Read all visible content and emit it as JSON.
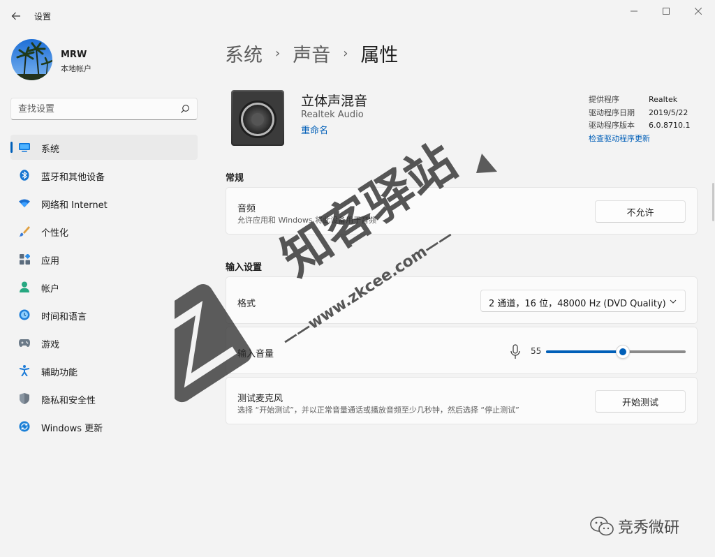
{
  "window": {
    "title": "设置"
  },
  "user": {
    "name": "MRW",
    "account_type": "本地帐户"
  },
  "search": {
    "placeholder": "查找设置"
  },
  "nav": {
    "items": [
      {
        "label": "系统",
        "icon": "monitor-icon",
        "active": true
      },
      {
        "label": "蓝牙和其他设备",
        "icon": "bluetooth-icon"
      },
      {
        "label": "网络和 Internet",
        "icon": "wifi-icon"
      },
      {
        "label": "个性化",
        "icon": "brush-icon"
      },
      {
        "label": "应用",
        "icon": "apps-icon"
      },
      {
        "label": "帐户",
        "icon": "person-icon"
      },
      {
        "label": "时间和语言",
        "icon": "globe-clock-icon"
      },
      {
        "label": "游戏",
        "icon": "gamepad-icon"
      },
      {
        "label": "辅助功能",
        "icon": "accessibility-icon"
      },
      {
        "label": "隐私和安全性",
        "icon": "shield-icon"
      },
      {
        "label": "Windows 更新",
        "icon": "update-icon"
      }
    ]
  },
  "breadcrumb": {
    "items": [
      "系统",
      "声音"
    ],
    "current": "属性",
    "separator": "›"
  },
  "device": {
    "name": "立体声混音",
    "subtitle": "Realtek Audio",
    "rename": "重命名",
    "info": [
      {
        "key": "提供程序",
        "value": "Realtek"
      },
      {
        "key": "驱动程序日期",
        "value": "2019/5/22"
      },
      {
        "key": "驱动程序版本",
        "value": "6.0.8710.1"
      }
    ],
    "driver_link": "检查驱动程序更新"
  },
  "general": {
    "heading": "常规",
    "audio": {
      "title": "音频",
      "desc": "允许应用和 Windows 将此设备用于音频",
      "button": "不允许"
    }
  },
  "input": {
    "heading": "输入设置",
    "format": {
      "title": "格式",
      "value": "2 通道，16 位，48000 Hz (DVD Quality)"
    },
    "volume": {
      "title": "输入音量",
      "value": "55",
      "level": 0.55
    },
    "test": {
      "title": "测试麦克风",
      "desc": "选择 “开始测试”，并以正常音量通话或播放音频至少几秒钟，然后选择 “停止测试”",
      "button": "开始测试"
    }
  },
  "watermark": {
    "brand": "知客驿站",
    "url": "——www.zkcee.com——",
    "wechat": "竞秀微研"
  },
  "colors": {
    "accent": "#005fb8",
    "background": "#f3f3f3",
    "card": "#fbfbfb"
  }
}
